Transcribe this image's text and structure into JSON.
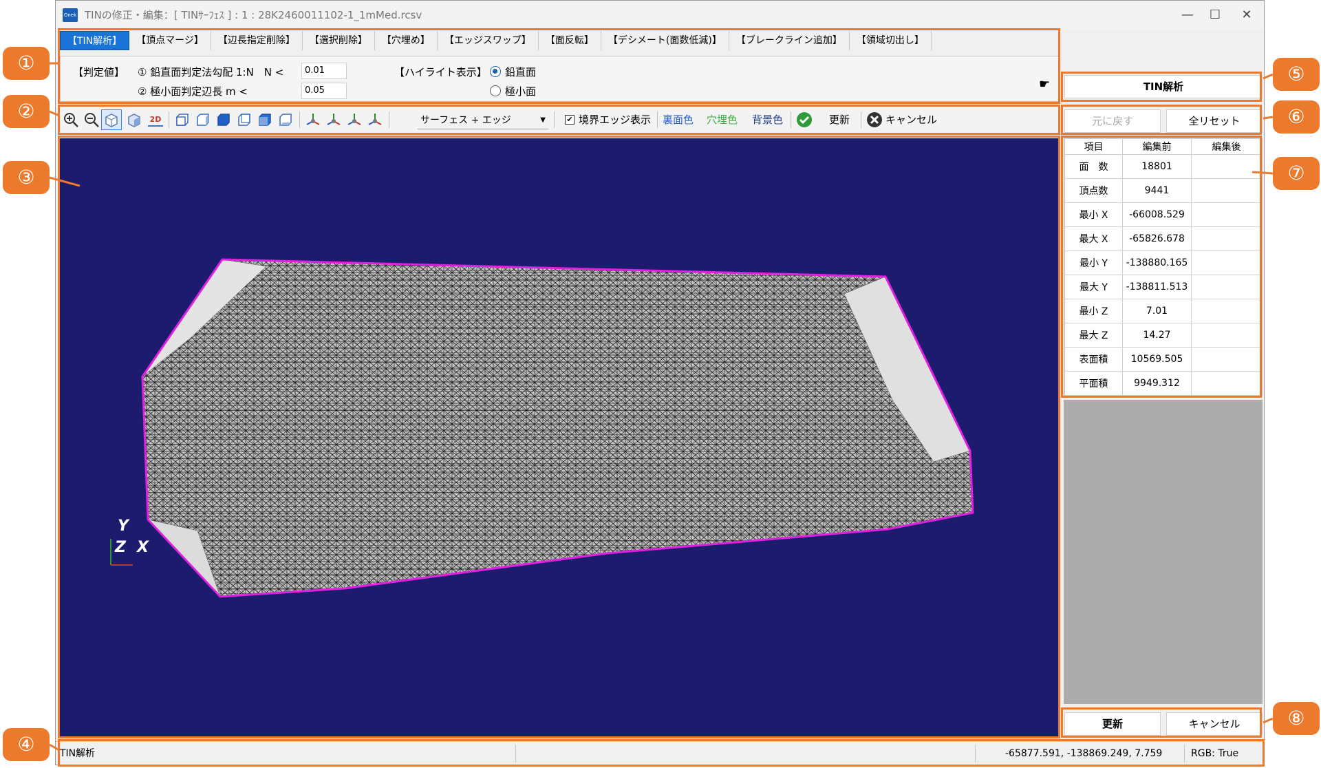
{
  "window": {
    "title": "TINの修正・編集：[ TINｻｰﾌｪｽ ] : 1 : 28K2460011102-1_1mMed.rcsv",
    "icon_label": "Onek",
    "controls": [
      "—",
      "☐",
      "✕"
    ]
  },
  "menu_tabs": [
    {
      "label": "【TIN解析】",
      "active": true
    },
    {
      "label": "【頂点マージ】",
      "active": false
    },
    {
      "label": "【辺長指定削除】",
      "active": false
    },
    {
      "label": "【選択削除】",
      "active": false
    },
    {
      "label": "【穴埋め】",
      "active": false
    },
    {
      "label": "【エッジスワップ】",
      "active": false
    },
    {
      "label": "【面反転】",
      "active": false
    },
    {
      "label": "【デシメート(面数低減)】",
      "active": false
    },
    {
      "label": "【ブレークライン追加】",
      "active": false
    },
    {
      "label": "【領域切出し】",
      "active": false
    }
  ],
  "params": {
    "judge_label": "【判定値】",
    "line1_label": "① 鉛直面判定法勾配 1:N　N <",
    "line1_value": "0.01",
    "line2_label": "② 極小面判定辺長 m <",
    "line2_value": "0.05",
    "highlight_label": "【ハイライト表示】",
    "radio_vertical": "鉛直面",
    "radio_small": "極小面",
    "selected": "鉛直面"
  },
  "toolbar": {
    "display_mode": "サーフェス + エッジ",
    "boundary_edge_label": "境界エッジ表示",
    "boundary_edge_checked": true,
    "back_color_label": "裏面色",
    "hole_color_label": "穴埋色",
    "bg_color_label": "背景色",
    "update_label": "更新",
    "cancel_label": "キャンセル",
    "view_2d_label": "2D"
  },
  "right_panel": {
    "analyze_button": "TIN解析",
    "undo_button": "元に戻す",
    "reset_button": "全リセット",
    "update_button": "更新",
    "cancel_button": "キャンセル"
  },
  "stats": {
    "headers": [
      "項目",
      "編集前",
      "編集後"
    ],
    "rows": [
      {
        "item": "面　数",
        "before": "18801",
        "after": ""
      },
      {
        "item": "頂点数",
        "before": "9441",
        "after": ""
      },
      {
        "item": "最小 X",
        "before": "-66008.529",
        "after": ""
      },
      {
        "item": "最大 X",
        "before": "-65826.678",
        "after": ""
      },
      {
        "item": "最小 Y",
        "before": "-138880.165",
        "after": ""
      },
      {
        "item": "最大 Y",
        "before": "-138811.513",
        "after": ""
      },
      {
        "item": "最小 Z",
        "before": "7.01",
        "after": ""
      },
      {
        "item": "最大 Z",
        "before": "14.27",
        "after": ""
      },
      {
        "item": "表面積",
        "before": "10569.505",
        "after": ""
      },
      {
        "item": "平面積",
        "before": "9949.312",
        "after": ""
      }
    ]
  },
  "axes": {
    "y": "Y",
    "z": "Z",
    "x": "X"
  },
  "status": {
    "mode": "TIN解析",
    "coords": "-65877.591, -138869.249, 7.759",
    "rgb": "RGB: True"
  },
  "callouts": [
    "①",
    "②",
    "③",
    "④",
    "⑤",
    "⑥",
    "⑦",
    "⑧"
  ],
  "colors": {
    "viewport_bg": "#1d1b6e",
    "boundary": "#e020e0",
    "mesh_fill": "#bfbfbf",
    "callout": "#ec7a2c",
    "tab_active": "#1a73d9"
  }
}
